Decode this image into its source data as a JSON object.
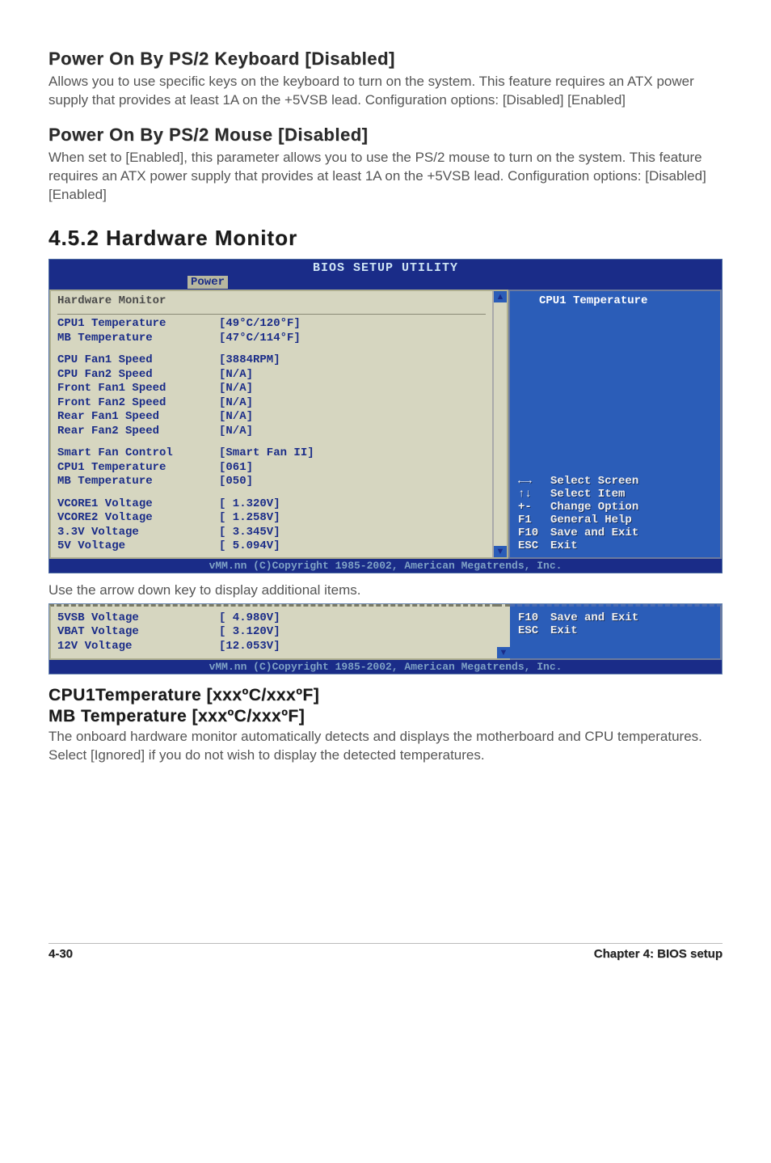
{
  "sectionA": {
    "title": "Power On By PS/2 Keyboard [Disabled]",
    "text": "Allows you to use specific keys on the keyboard to turn on the system. This feature requires an ATX power supply that provides at least 1A on the +5VSB lead. Configuration options: [Disabled] [Enabled]"
  },
  "sectionB": {
    "title": "Power On By PS/2 Mouse [Disabled]",
    "text": "When set to [Enabled], this parameter allows you to use the PS/2 mouse to turn on the system. This feature requires an ATX power supply that provides at least 1A on the +5VSB lead. Configuration options: [Disabled] [Enabled]"
  },
  "sectionNum": "4.5.2   Hardware Monitor",
  "bios": {
    "utilityTitle": "BIOS SETUP UTILITY",
    "tab": "Power",
    "panelTitle": "Hardware Monitor",
    "groups": [
      [
        {
          "label": "CPU1 Temperature",
          "value": "[49°C/120°F]"
        },
        {
          "label": "MB Temperature",
          "value": "[47°C/114°F]"
        }
      ],
      [
        {
          "label": "CPU Fan1 Speed",
          "value": "[3884RPM]"
        },
        {
          "label": "CPU Fan2 Speed",
          "value": "[N/A]"
        },
        {
          "label": "Front Fan1 Speed",
          "value": "[N/A]"
        },
        {
          "label": "Front Fan2 Speed",
          "value": "[N/A]"
        },
        {
          "label": "Rear Fan1 Speed",
          "value": "[N/A]"
        },
        {
          "label": "Rear Fan2 Speed",
          "value": "[N/A]"
        }
      ],
      [
        {
          "label": "Smart Fan Control",
          "value": "[Smart Fan II]"
        },
        {
          "label": "CPU1 Temperature",
          "value": "[061]"
        },
        {
          "label": "MB Temperature",
          "value": "[050]"
        }
      ],
      [
        {
          "label": "VCORE1 Voltage",
          "value": "[ 1.320V]"
        },
        {
          "label": "VCORE2 Voltage",
          "value": "[ 1.258V]"
        },
        {
          "label": "3.3V Voltage",
          "value": "[ 3.345V]"
        },
        {
          "label": "5V Voltage",
          "value": "[ 5.094V]"
        }
      ]
    ],
    "rightTitle": "CPU1 Temperature",
    "keys": [
      {
        "k": "←→",
        "d": "Select Screen"
      },
      {
        "k": "↑↓",
        "d": "Select Item"
      },
      {
        "k": "+-",
        "d": "Change Option"
      },
      {
        "k": "F1",
        "d": "General Help"
      },
      {
        "k": "F10",
        "d": "Save and Exit"
      },
      {
        "k": "ESC",
        "d": "Exit"
      }
    ],
    "copyright": "vMM.nn (C)Copyright 1985-2002, American Megatrends, Inc."
  },
  "arrowNote": "Use the arrow down key to display additional items.",
  "bios2": {
    "rows": [
      {
        "label": "5VSB Voltage",
        "value": "[ 4.980V]"
      },
      {
        "label": "VBAT Voltage",
        "value": "[ 3.120V]"
      },
      {
        "label": "12V Voltage",
        "value": "[12.053V]"
      }
    ],
    "keys": [
      {
        "k": "F10",
        "d": "Save and Exit"
      },
      {
        "k": "ESC",
        "d": "Exit"
      }
    ],
    "copyright": "vMM.nn (C)Copyright 1985-2002, American Megatrends, Inc."
  },
  "tempSection": {
    "line1": "CPU1Temperature [xxxºC/xxxºF]",
    "line2": "MB Temperature [xxxºC/xxxºF]",
    "text": "The onboard hardware monitor automatically detects and displays the motherboard and CPU temperatures. Select [Ignored] if you do not wish to display the detected temperatures."
  },
  "footer": {
    "left": "4-30",
    "right": "Chapter 4: BIOS setup"
  }
}
